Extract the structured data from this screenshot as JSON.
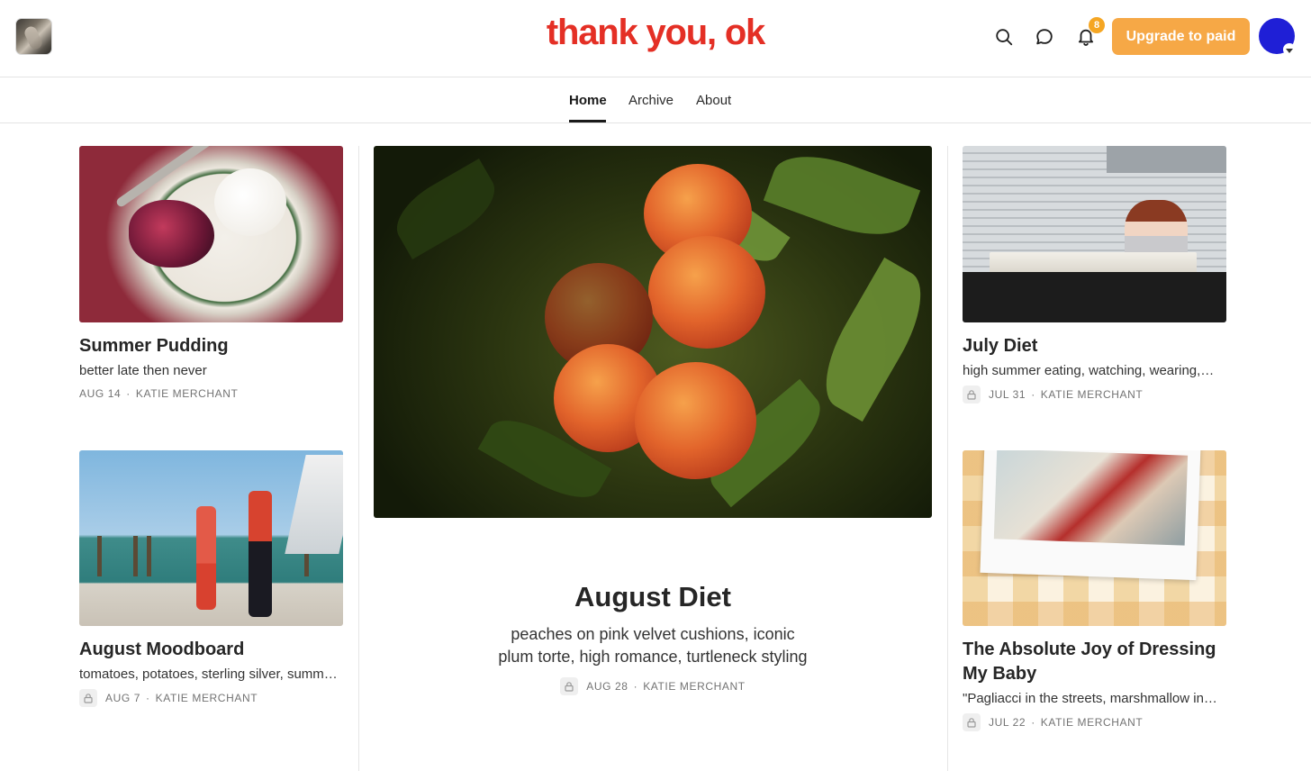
{
  "header": {
    "title": "thank you, ok",
    "upgrade_label": "Upgrade to paid",
    "notification_count": "8",
    "accent_color": "#e42f25",
    "upgrade_color": "#f6a846",
    "avatar_color": "#1f1fd6"
  },
  "nav": {
    "tabs": [
      {
        "label": "Home",
        "active": true
      },
      {
        "label": "Archive",
        "active": false
      },
      {
        "label": "About",
        "active": false
      }
    ]
  },
  "posts": {
    "left": [
      {
        "title": "Summer Pudding",
        "subtitle": "better late then never",
        "date": "AUG 14",
        "author": "KATIE MERCHANT",
        "locked": false
      },
      {
        "title": "August Moodboard",
        "subtitle": "tomatoes, potatoes, sterling silver, summ…",
        "date": "AUG 7",
        "author": "KATIE MERCHANT",
        "locked": true
      }
    ],
    "featured": {
      "title": "August Diet",
      "subtitle_line1": "peaches on pink velvet cushions, iconic",
      "subtitle_line2": "plum torte, high romance, turtleneck styling",
      "date": "AUG 28",
      "author": "KATIE MERCHANT",
      "locked": true
    },
    "right": [
      {
        "title": "July Diet",
        "subtitle": "high summer eating, watching, wearing,…",
        "date": "JUL 31",
        "author": "KATIE MERCHANT",
        "locked": true
      },
      {
        "title_line1": "The Absolute Joy of Dressing",
        "title_line2": "My Baby",
        "subtitle": "\"Pagliacci in the streets, marshmallow in…",
        "date": "JUL 22",
        "author": "KATIE MERCHANT",
        "locked": true
      }
    ],
    "separator": "·"
  },
  "icons": [
    "publication-logo-icon",
    "search-icon",
    "chat-icon",
    "bell-icon",
    "lock-icon",
    "caret-down-icon"
  ]
}
